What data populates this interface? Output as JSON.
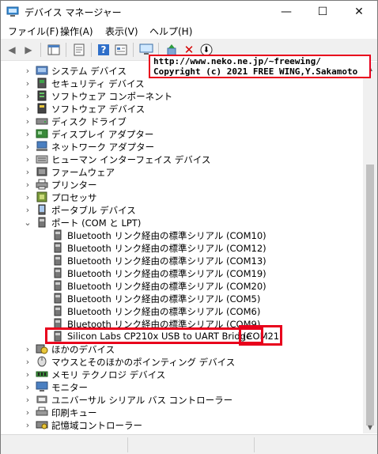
{
  "window": {
    "title": "デバイス マネージャー",
    "minimize_glyph": "—",
    "maximize_glyph": "☐",
    "close_glyph": "✕"
  },
  "menu": {
    "items": [
      "ファイル(F)",
      "操作(A)",
      "表示(V)",
      "ヘルプ(H)"
    ]
  },
  "toolbar": {
    "back_glyph": "◀",
    "forward_glyph": "▶",
    "help_glyph": "?",
    "remove_glyph": "✕",
    "update_glyph": "⬇"
  },
  "tooltip": {
    "line1": "http://www.neko.ne.jp/~freewing/",
    "line2": "Copyright (c) 2021 FREE WING,Y.Sakamoto"
  },
  "tree": {
    "collapsed_glyph": "›",
    "expanded_glyph": "⌄",
    "categories_top": [
      {
        "label": "システム デバイス",
        "icon": "system-device-icon"
      },
      {
        "label": "セキュリティ デバイス",
        "icon": "security-device-icon"
      },
      {
        "label": "ソフトウェア コンポーネント",
        "icon": "software-component-icon"
      },
      {
        "label": "ソフトウェア デバイス",
        "icon": "software-device-icon"
      },
      {
        "label": "ディスク ドライブ",
        "icon": "disk-drive-icon"
      },
      {
        "label": "ディスプレイ アダプター",
        "icon": "display-adapter-icon"
      },
      {
        "label": "ネットワーク アダプター",
        "icon": "network-adapter-icon"
      },
      {
        "label": "ヒューマン インターフェイス デバイス",
        "icon": "hid-icon"
      },
      {
        "label": "ファームウェア",
        "icon": "firmware-icon"
      },
      {
        "label": "プリンター",
        "icon": "printer-icon"
      },
      {
        "label": "プロセッサ",
        "icon": "processor-icon"
      },
      {
        "label": "ポータブル デバイス",
        "icon": "portable-device-icon"
      }
    ],
    "ports": {
      "label": "ポート (COM と LPT)",
      "children": [
        "Bluetooth リンク経由の標準シリアル (COM10)",
        "Bluetooth リンク経由の標準シリアル (COM12)",
        "Bluetooth リンク経由の標準シリアル (COM13)",
        "Bluetooth リンク経由の標準シリアル (COM19)",
        "Bluetooth リンク経由の標準シリアル (COM20)",
        "Bluetooth リンク経由の標準シリアル (COM5)",
        "Bluetooth リンク経由の標準シリアル (COM6)",
        "Bluetooth リンク経由の標準シリアル (COM9)"
      ],
      "selected_device": "Silicon Labs CP210x USB to UART Bridge",
      "selected_port": "(COM21)"
    },
    "categories_bottom": [
      {
        "label": "ほかのデバイス",
        "icon": "other-device-icon"
      },
      {
        "label": "マウスとそのほかのポインティング デバイス",
        "icon": "mouse-icon"
      },
      {
        "label": "メモリ テクノロジ デバイス",
        "icon": "memory-device-icon"
      },
      {
        "label": "モニター",
        "icon": "monitor-icon"
      },
      {
        "label": "ユニバーサル シリアル バス コントローラー",
        "icon": "usb-controller-icon"
      },
      {
        "label": "印刷キュー",
        "icon": "print-queue-icon"
      },
      {
        "label": "記憶域コントローラー",
        "icon": "storage-controller-icon"
      }
    ]
  },
  "colors": {
    "highlight_red": "#e8001c",
    "toolbar_bg": "#f0f0f0"
  }
}
